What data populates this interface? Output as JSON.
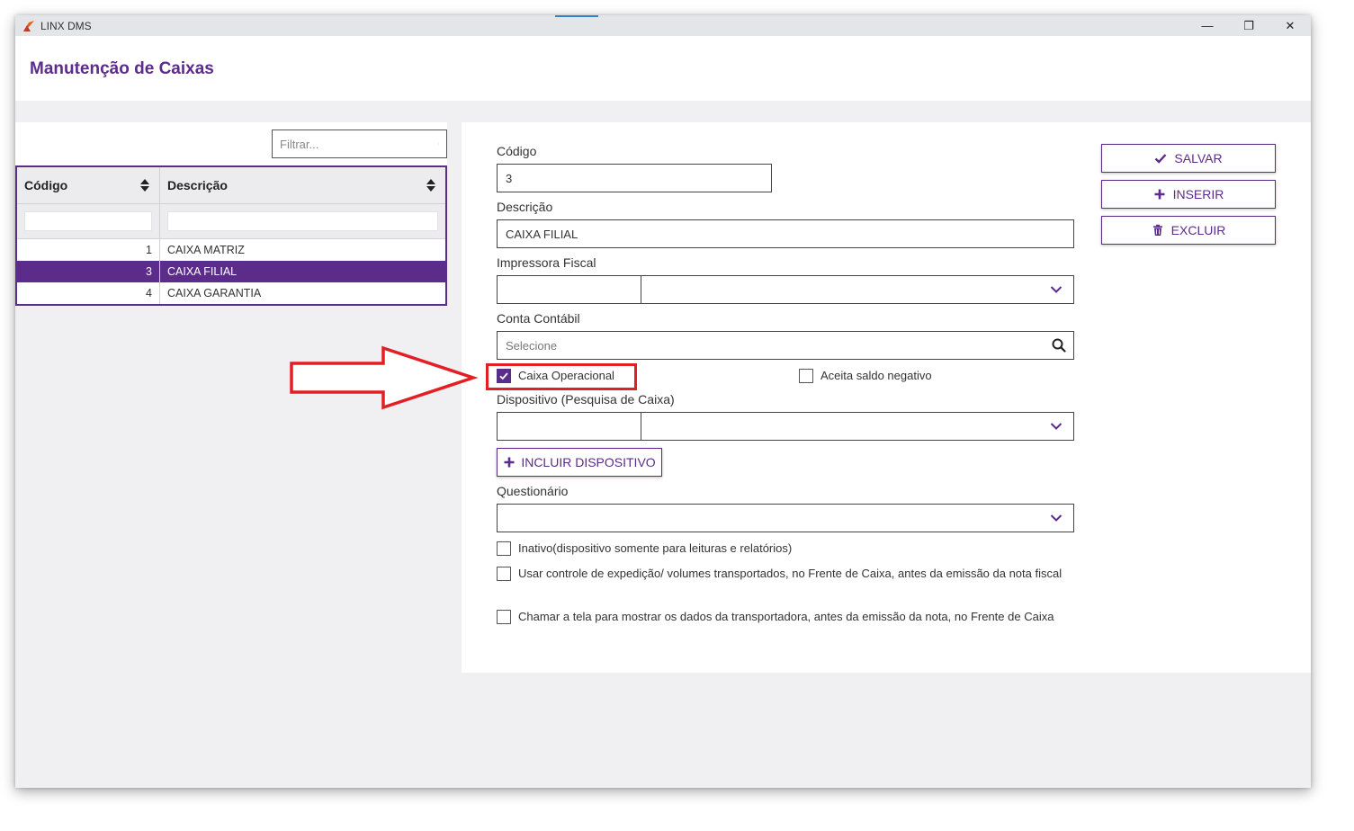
{
  "window": {
    "app_title": "LINX DMS",
    "controls": {
      "minimize": "—",
      "restore": "❐",
      "close": "✕"
    }
  },
  "header": {
    "title": "Manutenção de Caixas"
  },
  "list": {
    "filter_placeholder": "Filtrar...",
    "columns": [
      "Código",
      "Descrição"
    ],
    "rows": [
      {
        "code": "1",
        "desc": "CAIXA MATRIZ",
        "selected": false
      },
      {
        "code": "3",
        "desc": "CAIXA FILIAL",
        "selected": true
      },
      {
        "code": "4",
        "desc": "CAIXA GARANTIA",
        "selected": false
      }
    ]
  },
  "form": {
    "codigo_label": "Código",
    "codigo_value": "3",
    "descricao_label": "Descrição",
    "descricao_value": "CAIXA FILIAL",
    "impressora_label": "Impressora Fiscal",
    "conta_label": "Conta Contábil",
    "conta_placeholder": "Selecione",
    "caixa_operacional_label": "Caixa Operacional",
    "caixa_operacional_checked": true,
    "aceita_saldo_label": "Aceita saldo negativo",
    "aceita_saldo_checked": false,
    "dispositivo_label": "Dispositivo (Pesquisa de Caixa)",
    "incluir_dispositivo_label": "INCLUIR DISPOSITIVO",
    "questionario_label": "Questionário",
    "inativo_label": "Inativo(dispositivo somente para leituras e relatórios)",
    "usar_controle_label": "Usar controle de expedição/ volumes transportados, no Frente de Caixa, antes da emissão da nota fiscal",
    "chamar_tela_label": "Chamar a tela para mostrar os dados da transportadora, antes da emissão da nota, no Frente de Caixa"
  },
  "actions": {
    "salvar": "SALVAR",
    "inserir": "INSERIR",
    "excluir": "EXCLUIR"
  },
  "colors": {
    "brand_purple": "#5b2c8a",
    "annotation_red": "#e31e24"
  }
}
